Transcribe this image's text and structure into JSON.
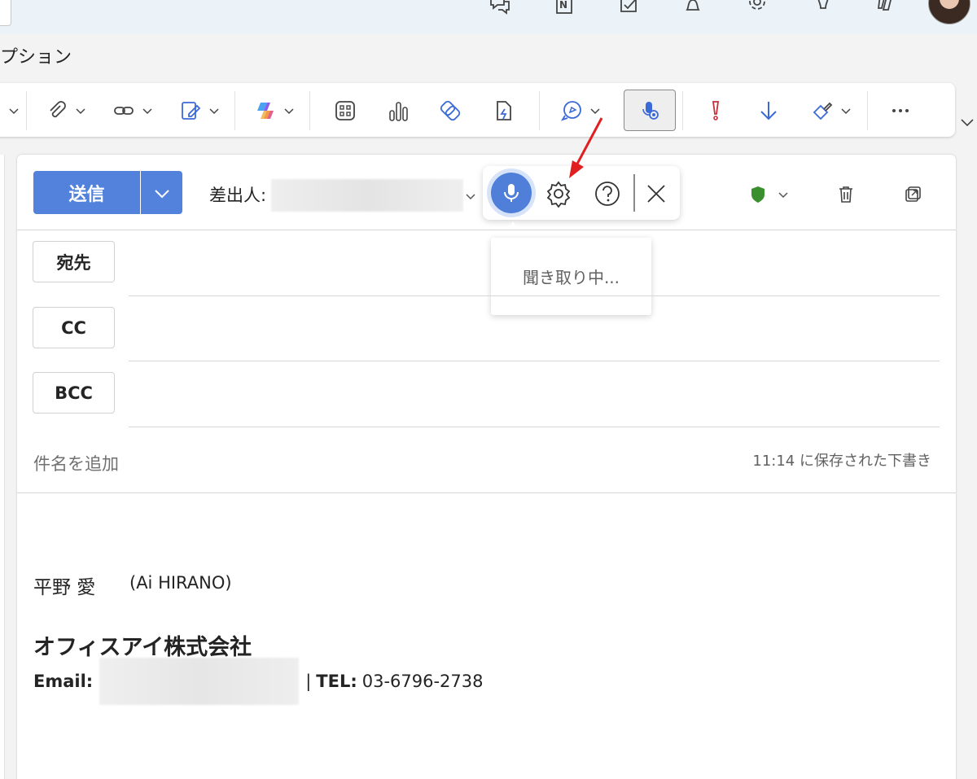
{
  "menu": {
    "options_tab": "プション"
  },
  "compose": {
    "send_label": "送信",
    "from_label": "差出人:",
    "to_label": "宛先",
    "cc_label": "CC",
    "bcc_label": "BCC",
    "subject_placeholder": "件名を追加",
    "draft_saved": "11:14 に保存された下書き"
  },
  "dictation": {
    "status": "聞き取り中..."
  },
  "signature": {
    "name": "平野 愛",
    "name_roman": "(Ai HIRANO)",
    "company": "オフィスアイ株式会社",
    "email_label": "Email:",
    "separator": "|",
    "tel_label": "TEL:",
    "tel": "03-6796-2738"
  },
  "colors": {
    "accent": "#5382dd",
    "shield": "#3a8f2f",
    "arrow": "#e02020",
    "priority": "#c4313b"
  },
  "icons": {
    "topbar": [
      "feedback-icon",
      "onenote-icon",
      "todo-icon",
      "bell-icon",
      "gear-icon",
      "lightbulb-icon",
      "copilot-icon"
    ],
    "ribbon": [
      "attach-icon",
      "link-icon",
      "signature-icon",
      "copilot-icon",
      "apps-icon",
      "poll-icon",
      "loop-icon",
      "quick-parts-icon",
      "editor-icon",
      "dictate-icon",
      "high-importance-icon",
      "low-importance-icon",
      "format-painter-icon",
      "more-icon"
    ]
  }
}
